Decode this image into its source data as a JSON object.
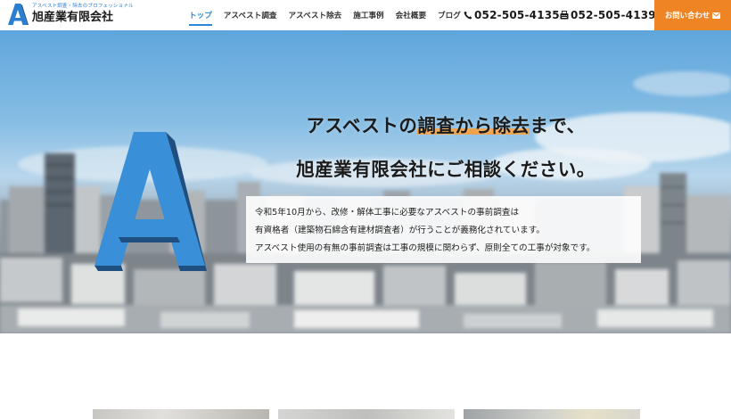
{
  "brand": {
    "tagline": "アスベスト調査・除去のプロフェッショナル",
    "name": "旭産業有限会社"
  },
  "nav": {
    "items": [
      {
        "label": "トップ",
        "active": true
      },
      {
        "label": "アスベスト調査",
        "active": false
      },
      {
        "label": "アスベスト除去",
        "active": false
      },
      {
        "label": "施工事例",
        "active": false
      },
      {
        "label": "会社概要",
        "active": false
      },
      {
        "label": "ブログ",
        "active": false
      }
    ]
  },
  "contact": {
    "tel": "052-505-4135",
    "fax": "052-505-4139",
    "cta_label": "お問い合わせ"
  },
  "hero": {
    "headline_line1_pre": "アスベストの",
    "headline_line1_mark": "調査から除去",
    "headline_line1_post": "まで、",
    "headline_line2": "旭産業有限会社にご相談ください。",
    "description": [
      "令和5年10月から、改修・解体工事に必要なアスベストの事前調査は",
      "有資格者（建築物石綿含有建材調査者）が行うことが義務化されています。",
      "アスベスト使用の有無の事前調査は工事の規模に関わらず、原則全ての工事が対象です。"
    ]
  },
  "colors": {
    "accent_blue": "#2b87d8",
    "cta_orange": "#ee8423",
    "highlight_orange": "#f0a046"
  },
  "icons": {
    "tel": "phone-icon",
    "fax": "fax-icon",
    "cta": "mail-icon"
  }
}
